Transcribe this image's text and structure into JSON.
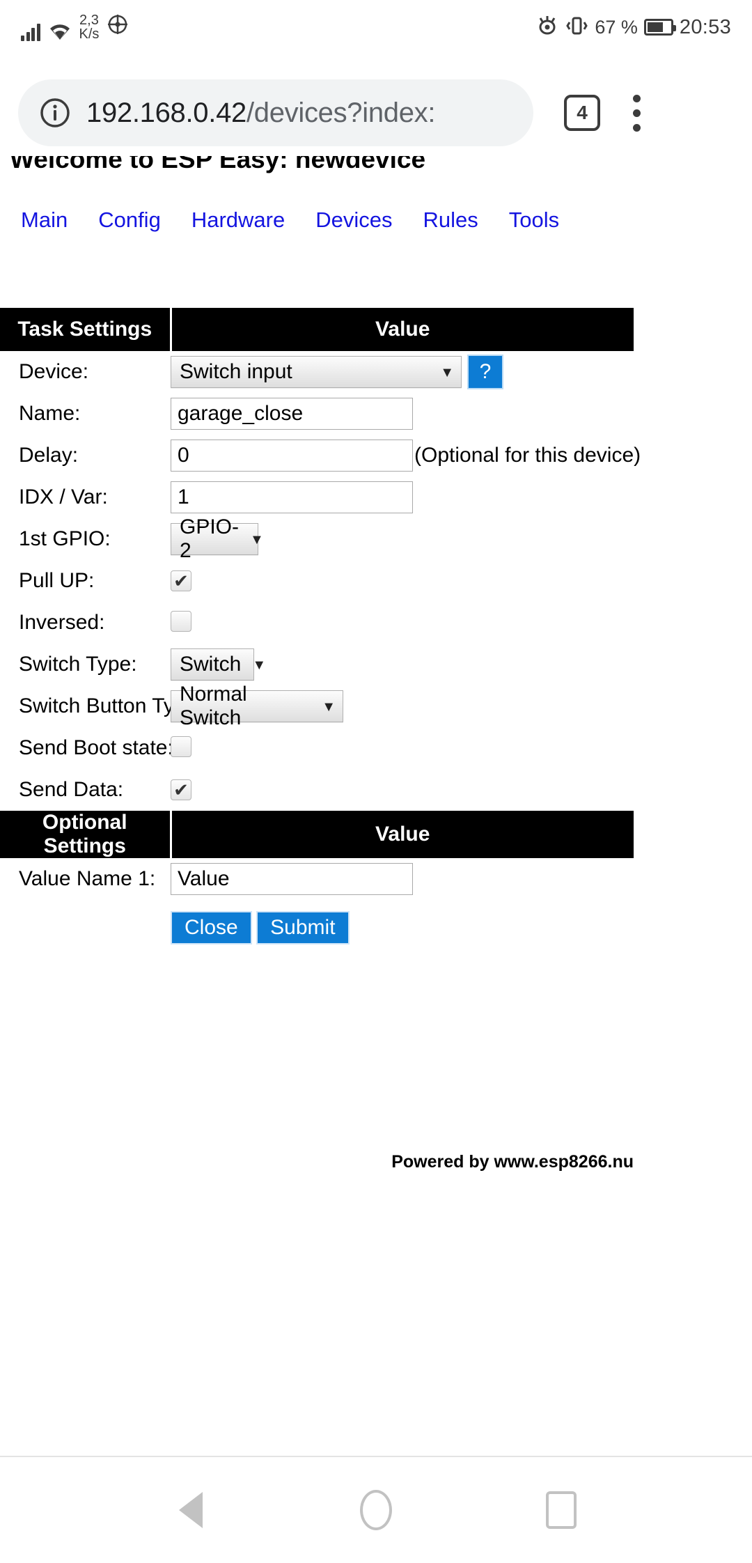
{
  "statusbar": {
    "network_speed": "2,3",
    "network_speed_unit": "K/s",
    "battery_percent": "67 %",
    "clock": "20:53",
    "icons": [
      "signal-icon",
      "wifi-icon",
      "location-icon",
      "eye-care-icon",
      "vibrate-icon",
      "battery-icon"
    ]
  },
  "browser": {
    "url_host": "192.168.0.42",
    "url_path": "/devices?index:",
    "tab_count": "4",
    "info_icon": "info-icon",
    "menu_icon": "kebab-menu-icon"
  },
  "page": {
    "title": "Welcome to ESP Easy: newdevice",
    "nav": [
      {
        "label": "Main"
      },
      {
        "label": "Config"
      },
      {
        "label": "Hardware"
      },
      {
        "label": "Devices"
      },
      {
        "label": "Rules"
      },
      {
        "label": "Tools"
      }
    ],
    "task_table": {
      "header_left": "Task Settings",
      "header_right": "Value",
      "rows": {
        "device_label": "Device:",
        "device_value": "Switch input",
        "device_help": "?",
        "name_label": "Name:",
        "name_value": "garage_close",
        "delay_label": "Delay:",
        "delay_value": "0",
        "delay_hint": "(Optional for this device)",
        "idx_label": "IDX / Var:",
        "idx_value": "1",
        "gpio_label": "1st GPIO:",
        "gpio_value": "GPIO-2",
        "pullup_label": "Pull UP:",
        "pullup_checked": "✔",
        "inversed_label": "Inversed:",
        "inversed_checked": "",
        "switchtype_label": "Switch Type:",
        "switchtype_value": "Switch",
        "switchbuttontype_label": "Switch Button Type:",
        "switchbuttontype_value": "Normal Switch",
        "sendboot_label": "Send Boot state:",
        "sendboot_checked": "",
        "senddata_label": "Send Data:",
        "senddata_checked": "✔"
      }
    },
    "optional_table": {
      "header_left": "Optional Settings",
      "header_right": "Value",
      "value_name_1_label": "Value Name 1:",
      "value_name_1_value": "Value"
    },
    "buttons": {
      "close": "Close",
      "submit": "Submit"
    },
    "footer": "Powered by www.esp8266.nu"
  },
  "system_nav": {
    "back": "back-button",
    "home": "home-button",
    "recents": "recents-button"
  },
  "colors": {
    "accent_blue": "#0d7cd4",
    "link_blue": "#1414e0",
    "header_black": "#000000"
  }
}
